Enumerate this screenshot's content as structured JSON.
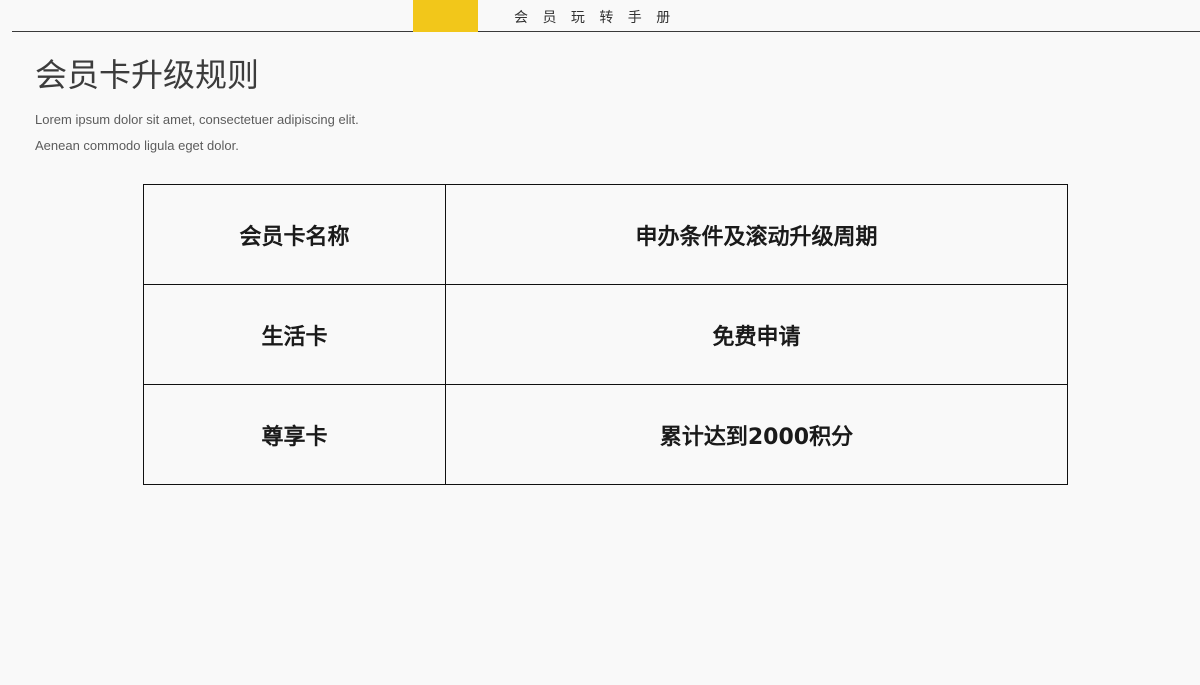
{
  "header": {
    "title": "会 员 玩 转 手 册",
    "accent_color": "#f2c71a"
  },
  "page": {
    "title": "会员卡升级规则",
    "subtitle_lines": [
      "Lorem ipsum dolor sit amet, consectetuer adipiscing elit.",
      "Aenean commodo ligula eget dolor."
    ]
  },
  "table": {
    "headers": [
      "会员卡名称",
      "申办条件及滚动升级周期"
    ],
    "rows": [
      [
        "生活卡",
        "免费申请"
      ],
      [
        "尊享卡",
        "累计达到2000积分"
      ]
    ]
  }
}
